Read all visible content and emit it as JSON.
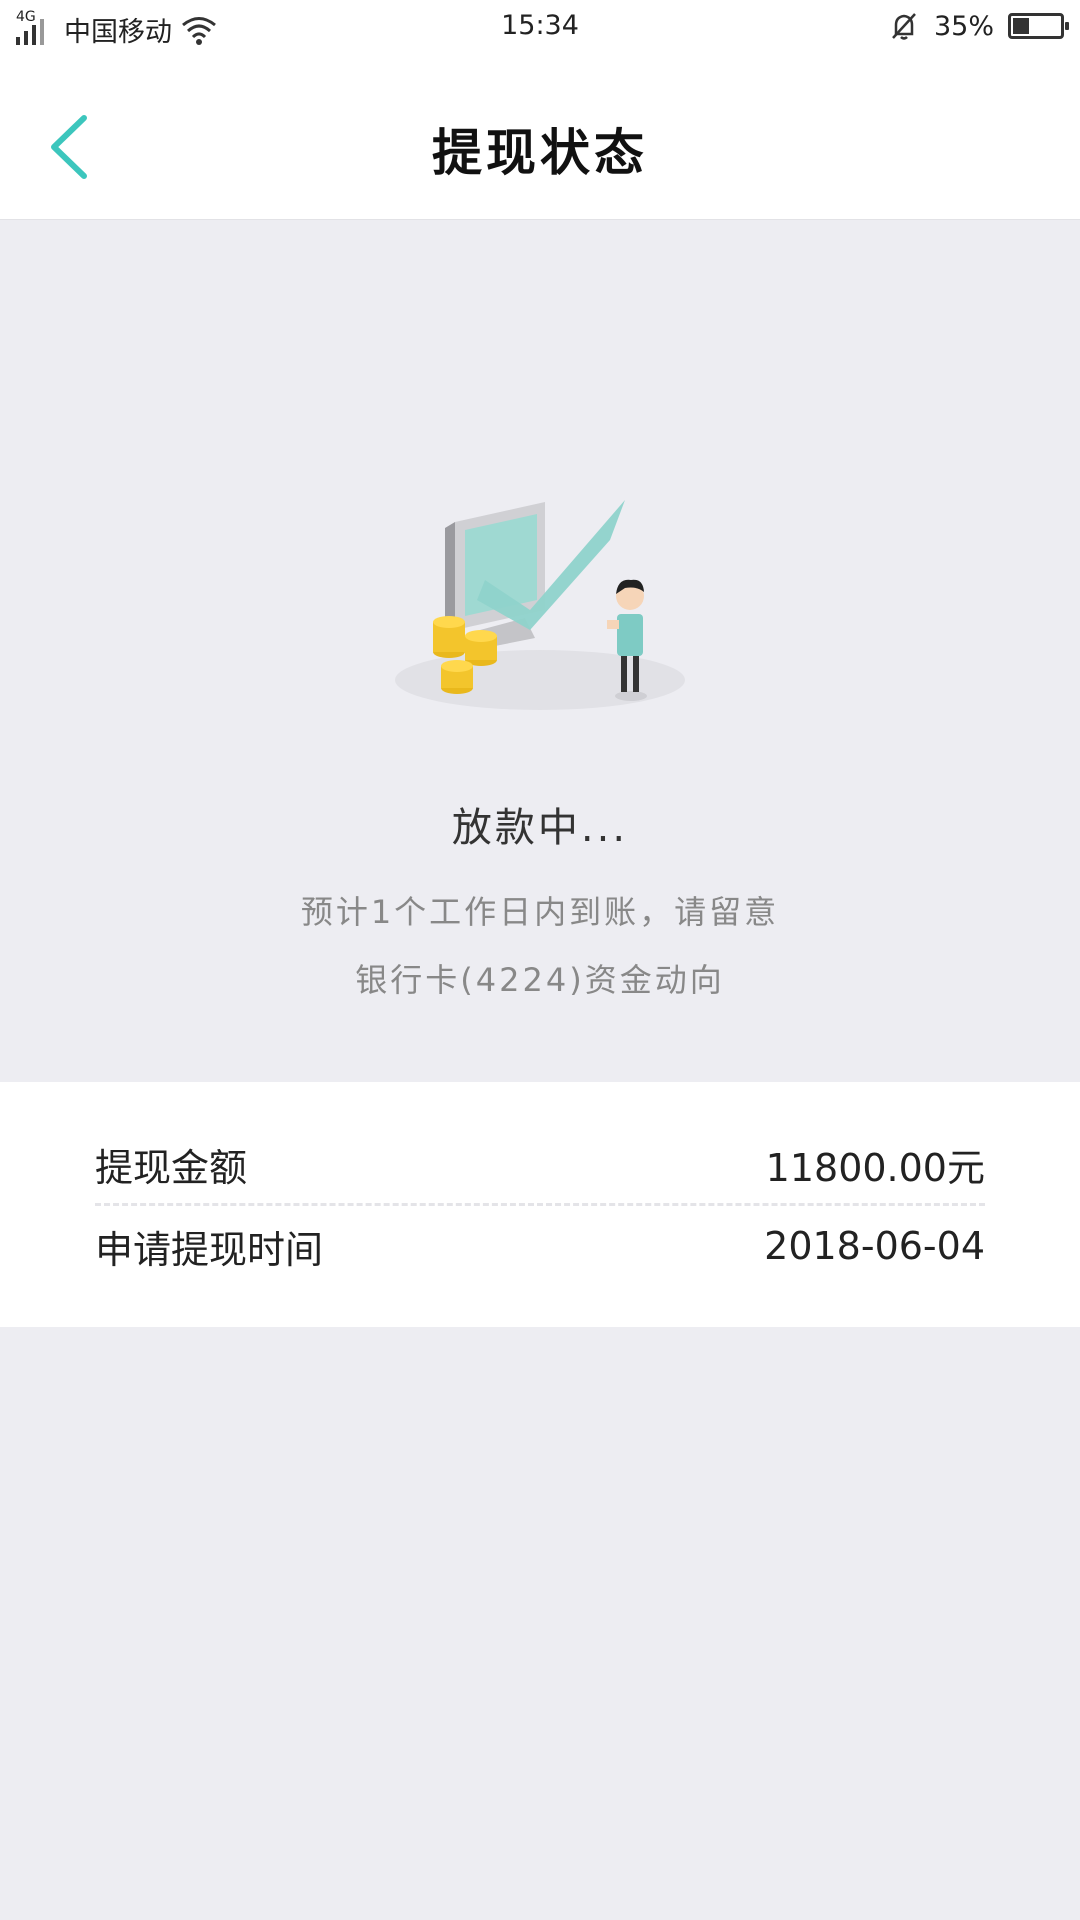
{
  "status_bar": {
    "network": "4G",
    "carrier": "中国移动",
    "time": "15:34",
    "battery_percent": "35%"
  },
  "navbar": {
    "title": "提现状态"
  },
  "status": {
    "title": "放款中...",
    "desc_line1": "预计1个工作日内到账，请留意",
    "desc_line2": "银行卡(4224)资金动向"
  },
  "details": [
    {
      "label": "提现金额",
      "value": "11800.00元"
    },
    {
      "label": "申请提现时间",
      "value": "2018-06-04"
    }
  ],
  "colors": {
    "accent": "#3cc6bd",
    "background": "#ededf2",
    "card": "#ffffff"
  }
}
